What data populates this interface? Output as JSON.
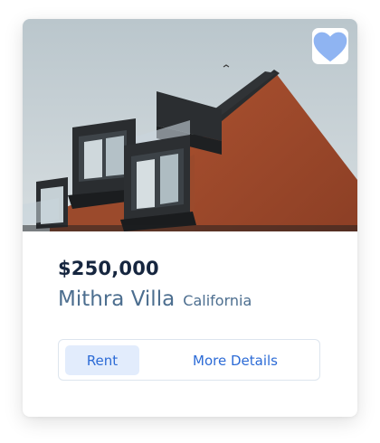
{
  "listing": {
    "price": "$250,000",
    "name": "Mithra Villa",
    "location": "California"
  },
  "actions": {
    "rent_label": "Rent",
    "details_label": "More Details"
  },
  "icons": {
    "favorite": "heart-icon"
  },
  "colors": {
    "accent": "#2c6bd6",
    "rent_bg": "#e2ecfc",
    "heart": "#8fb4f2",
    "price": "#16263f",
    "subtitle": "#4c6e8f"
  }
}
